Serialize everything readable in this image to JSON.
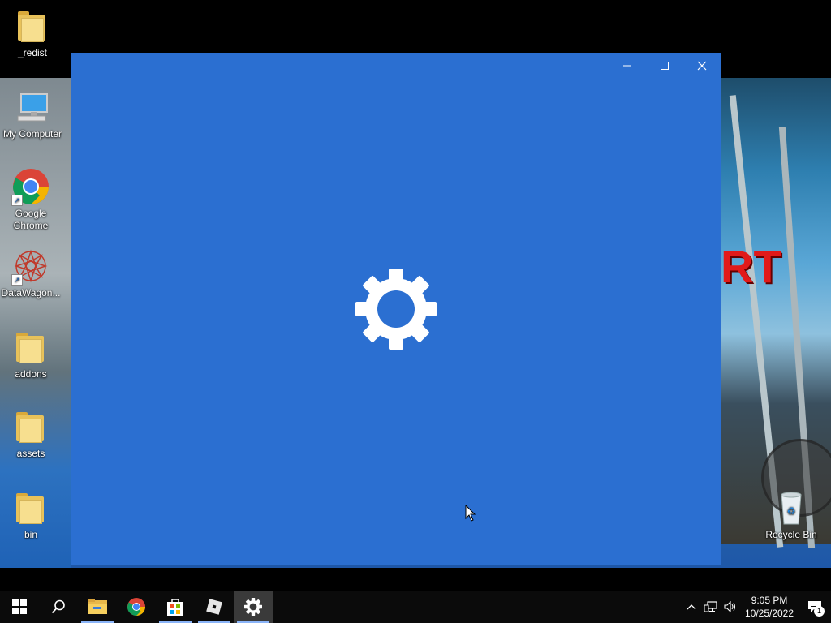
{
  "desktop": {
    "icons": [
      {
        "label": "_redist",
        "icon": "folder-icon"
      },
      {
        "label": "My Computer",
        "icon": "computer-icon"
      },
      {
        "label": "Google Chrome",
        "icon": "chrome-icon"
      },
      {
        "label": "DataWagon...",
        "icon": "datawagon-icon"
      },
      {
        "label": "addons",
        "icon": "folder-icon"
      },
      {
        "label": "assets",
        "icon": "folder-icon"
      },
      {
        "label": "bin",
        "icon": "folder-icon"
      },
      {
        "label": "Recycle Bin",
        "icon": "recycle-bin-icon"
      }
    ],
    "wallpaper_text": "RT"
  },
  "window": {
    "app": "Settings",
    "background": "#2b6fd1",
    "splash_icon": "gear-icon",
    "controls": {
      "minimize": "minimize-icon",
      "maximize": "maximize-icon",
      "close": "close-icon"
    }
  },
  "taskbar": {
    "buttons": [
      {
        "name": "start",
        "icon": "windows-logo-icon"
      },
      {
        "name": "search",
        "icon": "search-icon"
      },
      {
        "name": "file-explorer",
        "icon": "folder-icon"
      },
      {
        "name": "chrome",
        "icon": "chrome-icon"
      },
      {
        "name": "store",
        "icon": "store-icon"
      },
      {
        "name": "roblox",
        "icon": "roblox-icon"
      },
      {
        "name": "settings",
        "icon": "gear-icon",
        "active": true
      }
    ],
    "tray": {
      "time": "9:05 PM",
      "date": "10/25/2022",
      "notification_count": "1"
    }
  }
}
